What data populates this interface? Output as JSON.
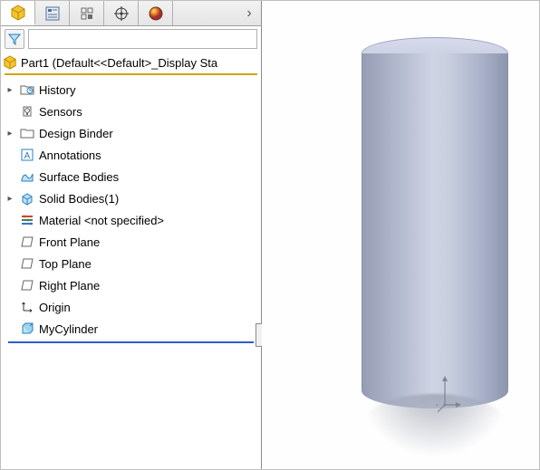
{
  "root": {
    "label": "Part1  (Default<<Default>_Display Sta"
  },
  "tree": {
    "items": [
      {
        "label": "History",
        "caret": "▸"
      },
      {
        "label": "Sensors",
        "caret": ""
      },
      {
        "label": "Design Binder",
        "caret": "▸"
      },
      {
        "label": "Annotations",
        "caret": ""
      },
      {
        "label": "Surface Bodies",
        "caret": ""
      },
      {
        "label": "Solid Bodies(1)",
        "caret": "▸"
      },
      {
        "label": "Material <not specified>",
        "caret": ""
      },
      {
        "label": "Front Plane",
        "caret": ""
      },
      {
        "label": "Top Plane",
        "caret": ""
      },
      {
        "label": "Right Plane",
        "caret": ""
      },
      {
        "label": "Origin",
        "caret": ""
      },
      {
        "label": "MyCylinder",
        "caret": ""
      }
    ]
  },
  "tabs": {
    "chevron": "›"
  }
}
